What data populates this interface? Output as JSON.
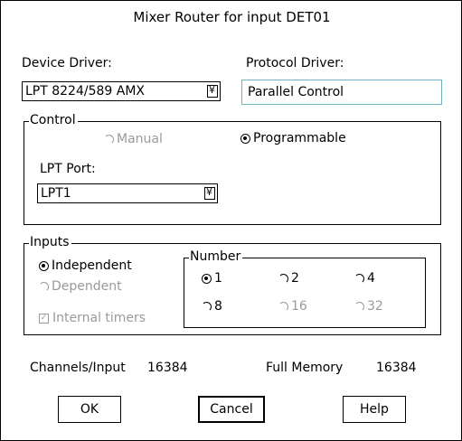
{
  "window": {
    "title": "Mixer Router for input DET01"
  },
  "device_driver": {
    "label": "Device Driver:",
    "value": "LPT 8224/589 AMX",
    "dropdown_glyph": "¥"
  },
  "protocol_driver": {
    "label": "Protocol Driver:",
    "value": "Parallel Control"
  },
  "control": {
    "group_label": "Control",
    "manual": {
      "label": "Manual",
      "checked": false,
      "enabled": false
    },
    "programmable": {
      "label": "Programmable",
      "checked": true,
      "enabled": true
    },
    "lpt_port": {
      "label": "LPT Port:",
      "value": "LPT1",
      "dropdown_glyph": "¥"
    }
  },
  "inputs": {
    "group_label": "Inputs",
    "independent": {
      "label": "Independent",
      "checked": true,
      "enabled": true
    },
    "dependent": {
      "label": "Dependent",
      "checked": false,
      "enabled": false
    },
    "internal_timers": {
      "label": "Internal timers",
      "checked": true,
      "enabled": false
    },
    "number": {
      "group_label": "Number",
      "options": [
        {
          "label": "1",
          "checked": true,
          "enabled": true
        },
        {
          "label": "2",
          "checked": false,
          "enabled": true
        },
        {
          "label": "4",
          "checked": false,
          "enabled": true
        },
        {
          "label": "8",
          "checked": false,
          "enabled": true
        },
        {
          "label": "16",
          "checked": false,
          "enabled": false
        },
        {
          "label": "32",
          "checked": false,
          "enabled": false
        }
      ]
    }
  },
  "stats": {
    "channels_label": "Channels/Input",
    "channels_value": "16384",
    "memory_label": "Full Memory",
    "memory_value": "16384"
  },
  "buttons": {
    "ok": "OK",
    "cancel": "Cancel",
    "help": "Help"
  }
}
